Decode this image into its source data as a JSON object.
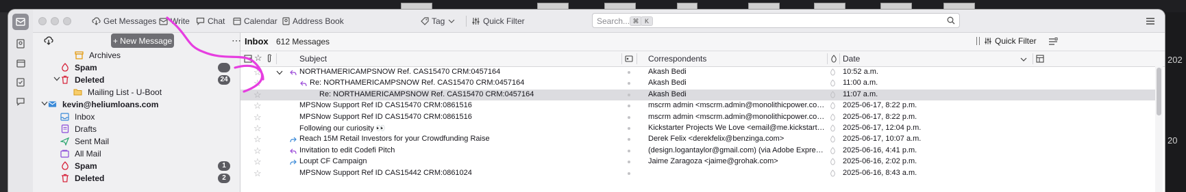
{
  "toolbar": {
    "get_messages": "Get Messages",
    "write": "Write",
    "chat": "Chat",
    "calendar": "Calendar",
    "address_book": "Address Book",
    "tag": "Tag",
    "quick_filter": "Quick Filter",
    "search_placeholder": "Search...",
    "search_key1": "⌘",
    "search_key2": "K"
  },
  "folder_pane": {
    "new_message": "+ New Message",
    "folders": [
      {
        "label": "Archives",
        "icon": "archive-icon"
      },
      {
        "label": "Spam",
        "icon": "spam-icon",
        "bold": true,
        "badge": ""
      },
      {
        "label": "Deleted",
        "icon": "trash-icon",
        "bold": true,
        "badge": "24"
      },
      {
        "label": "Mailing List - U-Boot",
        "icon": "folder-icon"
      },
      {
        "label": "kevin@heliumloans.com",
        "icon": "account-icon",
        "bold": true
      },
      {
        "label": "Inbox",
        "icon": "inbox-icon"
      },
      {
        "label": "Drafts",
        "icon": "drafts-icon"
      },
      {
        "label": "Sent Mail",
        "icon": "sent-icon"
      },
      {
        "label": "All Mail",
        "icon": "allmail-icon"
      },
      {
        "label": "Spam",
        "icon": "spam-icon",
        "bold": true,
        "badge": "1"
      },
      {
        "label": "Deleted",
        "icon": "trash-icon",
        "bold": true,
        "badge": "2"
      }
    ]
  },
  "message_pane": {
    "folder_name": "Inbox",
    "message_count": "612 Messages",
    "quick_filter": "Quick Filter",
    "columns": {
      "subject": "Subject",
      "correspondents": "Correspondents",
      "date": "Date"
    },
    "messages": [
      {
        "subject": "NORTHAMERICAMPSNOW Ref. CAS15470 CRM:0457164",
        "from": "Akash Bedi",
        "date": "10:52 a.m.",
        "thread": "open",
        "status": "replied"
      },
      {
        "subject": "Re: NORTHAMERICAMPSNOW Ref. CAS15470 CRM:0457164",
        "from": "Akash Bedi",
        "date": "11:00 a.m.",
        "status": "replied",
        "indent": 1
      },
      {
        "subject": "Re: NORTHAMERICAMPSNOW Ref. CAS15470 CRM:0457164",
        "from": "Akash Bedi",
        "date": "11:07 a.m.",
        "indent": 2,
        "selected": true
      },
      {
        "subject": "MPSNow Support Ref ID CAS15470 CRM:0861516",
        "from": "mscrm admin <mscrm.admin@monolithicpower.com>",
        "date": "2025-06-17, 8:22 p.m."
      },
      {
        "subject": "MPSNow Support Ref ID CAS15470 CRM:0861516",
        "from": "mscrm admin <mscrm.admin@monolithicpower.com>",
        "date": "2025-06-17, 8:22 p.m."
      },
      {
        "subject": "Following our curiosity 👀",
        "from": "Kickstarter Projects We Love <email@me.kickstarter...",
        "date": "2025-06-17, 12:04 p.m."
      },
      {
        "subject": "Reach 15M Retail Investors for your Crowdfunding Raise",
        "from": "Derek Felix <derekfelix@benzinga.com>",
        "date": "2025-06-17, 10:07 a.m.",
        "status": "forwarded"
      },
      {
        "subject": "Invitation to edit Codefi Pitch",
        "from": "(design.logantaylor@gmail.com) (via Adobe Express...",
        "date": "2025-06-16, 4:41 p.m.",
        "status": "replied"
      },
      {
        "subject": "Loupt CF Campaign",
        "from": "Jaime Zaragoza <jaime@grohak.com>",
        "date": "2025-06-16, 2:02 p.m.",
        "status": "forwarded"
      },
      {
        "subject": "MPSNow Support Ref ID CAS15442 CRM:0861024",
        "from": "",
        "date": "2025-06-16, 8:43 a.m."
      }
    ]
  },
  "desktop": {
    "right_edge_labels": [
      "202",
      "20"
    ]
  },
  "colors": {
    "annotation": "#e63ee0",
    "replied_arrow": "#9b4ad8",
    "forwarded_arrow": "#3b8ad8",
    "selected_row": "#dcdce0"
  }
}
